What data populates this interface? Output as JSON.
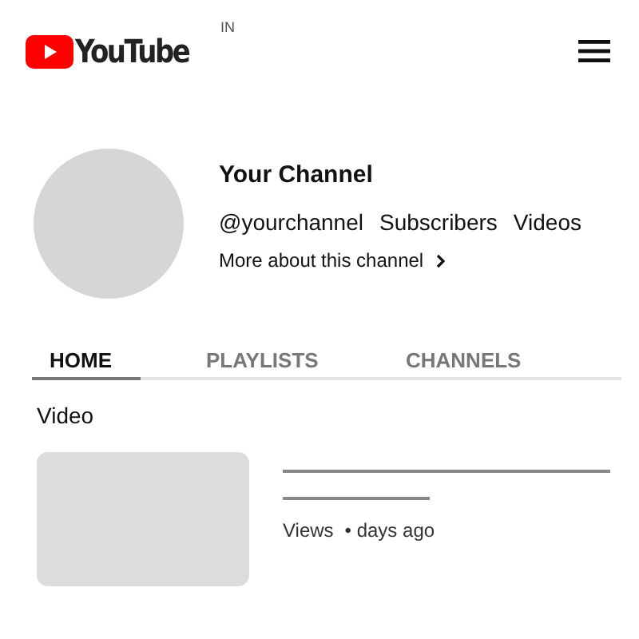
{
  "header": {
    "logo_text": "YouTube",
    "country_code": "IN"
  },
  "channel": {
    "name": "Your Channel",
    "handle": "@yourchannel",
    "stats": [
      "Subscribers",
      "Videos"
    ],
    "about_link": "More about this channel"
  },
  "tabs": [
    {
      "label": "HOME",
      "selected": true
    },
    {
      "label": "PLAYLISTS",
      "selected": false
    },
    {
      "label": "CHANNELS",
      "selected": false
    }
  ],
  "section": {
    "title": "Video",
    "videos": [
      {
        "views": "Views",
        "age": "• days ago"
      }
    ]
  }
}
